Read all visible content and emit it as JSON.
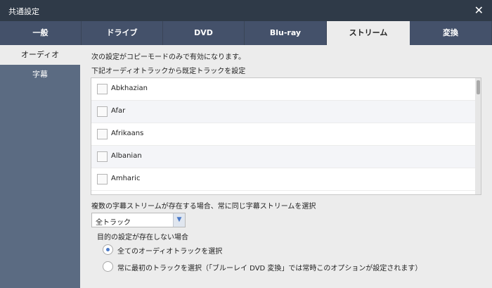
{
  "window": {
    "title": "共通設定",
    "close_icon": "close-icon"
  },
  "tabs": [
    {
      "label": "一般"
    },
    {
      "label": "ドライブ"
    },
    {
      "label": "DVD"
    },
    {
      "label": "Blu-ray"
    },
    {
      "label": "ストリーム",
      "active": true
    },
    {
      "label": "変換"
    }
  ],
  "sidebar": {
    "items": [
      {
        "label": "オーディオ",
        "active": true
      },
      {
        "label": "字幕"
      }
    ]
  },
  "main": {
    "note": "次の設定がコピーモードのみで有効になります。",
    "audio_label": "下記オーディオトラックから既定トラックを設定",
    "languages": [
      "Abkhazian",
      "Afar",
      "Afrikaans",
      "Albanian",
      "Amharic"
    ],
    "multi_subtitle_label": "複数の字幕ストリームが存在する場合、常に同じ字幕ストリームを選択",
    "track_select_value": "全トラック",
    "fallback_label": "目的の設定が存在しない場合",
    "radio_all": "全てのオーディオトラックを選択",
    "radio_first": "常に最初のトラックを選択（「ブルーレイ DVD 変換」では常時このオプションが設定されます）"
  },
  "colors": {
    "titlebar": "#2f3a48",
    "tabbar": "#44516a",
    "sidebar": "#5b6b82",
    "panel": "#ececec",
    "accent": "#4a79c7"
  }
}
